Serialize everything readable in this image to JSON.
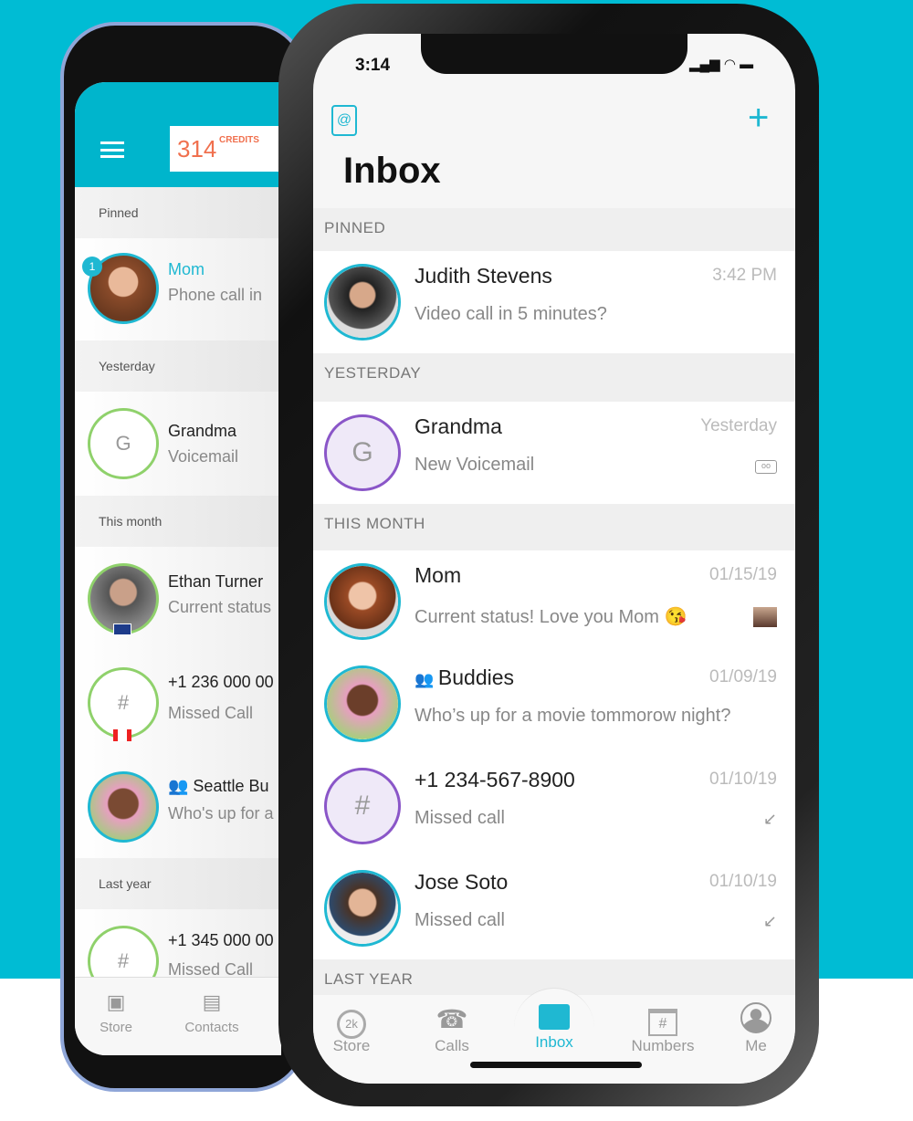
{
  "colors": {
    "accent": "#00bcd4",
    "credits": "#f0704e",
    "group_avatar": "#8a56c8"
  },
  "back_phone": {
    "credits": {
      "value": "314",
      "label": "CREDITS"
    },
    "sections": [
      "Pinned",
      "Yesterday",
      "This month",
      "Last year"
    ],
    "rows": [
      {
        "name": "Mom",
        "sub": "Phone call in",
        "badge": "1"
      },
      {
        "name": "Grandma",
        "sub": "Voicemail",
        "initial": "G"
      },
      {
        "name": "Ethan Turner",
        "sub": "Current status",
        "flag": "uk"
      },
      {
        "name": "+1 236 000 00",
        "sub": "Missed Call",
        "initial": "#",
        "flag": "canada"
      },
      {
        "name": "Seattle Bu",
        "sub": "Who's up for a",
        "icon": "group-icon"
      },
      {
        "name": "+1 345 000 00",
        "sub": "Missed Call",
        "initial": "#"
      }
    ],
    "tabs": [
      "Store",
      "Contacts"
    ]
  },
  "front_phone": {
    "status_time": "3:14",
    "title": "Inbox",
    "sections": [
      "PINNED",
      "YESTERDAY",
      "THIS MONTH",
      "LAST YEAR"
    ],
    "rows": [
      {
        "name": "Judith Stevens",
        "sub": "Video call in 5 minutes?",
        "time": "3:42 PM"
      },
      {
        "name": "Grandma",
        "sub": "New Voicemail",
        "time": "Yesterday",
        "initial": "G",
        "icon": "voicemail-icon"
      },
      {
        "name": "Mom",
        "sub": "Current status! Love you Mom 😘",
        "time": "01/15/19",
        "icon": "photo-thumbnail"
      },
      {
        "name": "Buddies",
        "sub": "Who’s up for a movie tommorow night?",
        "time": "01/09/19",
        "icon": "group-icon"
      },
      {
        "name": "+1 234-567-8900",
        "sub": "Missed call",
        "time": "01/10/19",
        "initial": "#",
        "icon": "missed-call-icon"
      },
      {
        "name": "Jose Soto",
        "sub": "Missed call",
        "time": "01/10/19",
        "icon": "missed-call-icon"
      }
    ],
    "tabs": [
      {
        "label": "Store",
        "glyph": "2k"
      },
      {
        "label": "Calls",
        "glyph": "☎"
      },
      {
        "label": "Inbox",
        "glyph": "📥",
        "active": true
      },
      {
        "label": "Numbers",
        "glyph": "#"
      },
      {
        "label": "Me",
        "glyph": "👤"
      }
    ]
  }
}
